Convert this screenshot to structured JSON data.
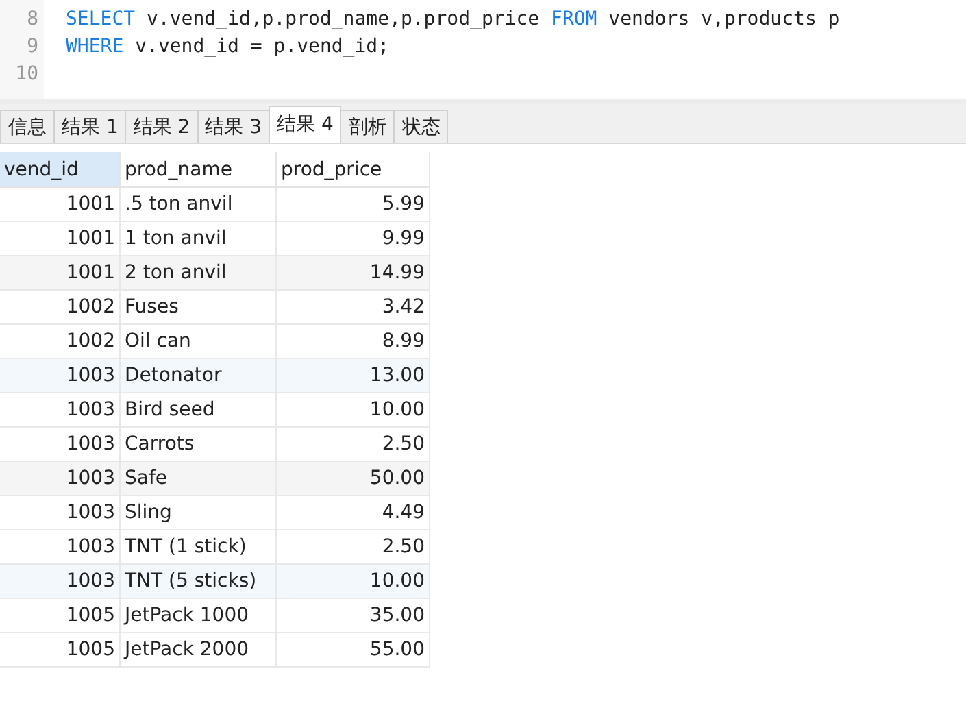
{
  "editor": {
    "lines": [
      {
        "number": "8",
        "tokens": [
          {
            "kind": "keyword",
            "text": "SELECT"
          },
          {
            "kind": "plain",
            "text": " v.vend_id,p.prod_name,p.prod_price "
          },
          {
            "kind": "keyword",
            "text": "FROM"
          },
          {
            "kind": "plain",
            "text": " vendors v,products p"
          }
        ]
      },
      {
        "number": "9",
        "tokens": [
          {
            "kind": "keyword",
            "text": "WHERE"
          },
          {
            "kind": "plain",
            "text": " v.vend_id = p.vend_id;"
          }
        ]
      },
      {
        "number": "10"
      }
    ]
  },
  "tabs": [
    {
      "label": "信息",
      "selected": false
    },
    {
      "label": "结果 1",
      "selected": false
    },
    {
      "label": "结果 2",
      "selected": false
    },
    {
      "label": "结果 3",
      "selected": false
    },
    {
      "label": "结果 4",
      "selected": true
    },
    {
      "label": "剖析",
      "selected": false
    },
    {
      "label": "状态",
      "selected": false
    }
  ],
  "table": {
    "columns": [
      {
        "label": "vend_id",
        "selected": true
      },
      {
        "label": "prod_name",
        "selected": false
      },
      {
        "label": "prod_price",
        "selected": false
      }
    ],
    "rows": [
      [
        "1001",
        ".5 ton anvil",
        "5.99"
      ],
      [
        "1001",
        "1 ton anvil",
        "9.99"
      ],
      [
        "1001",
        "2 ton anvil",
        "14.99"
      ],
      [
        "1002",
        "Fuses",
        "3.42"
      ],
      [
        "1002",
        "Oil can",
        "8.99"
      ],
      [
        "1003",
        "Detonator",
        "13.00"
      ],
      [
        "1003",
        "Bird seed",
        "10.00"
      ],
      [
        "1003",
        "Carrots",
        "2.50"
      ],
      [
        "1003",
        "Safe",
        "50.00"
      ],
      [
        "1003",
        "Sling",
        "4.49"
      ],
      [
        "1003",
        "TNT (1 stick)",
        "2.50"
      ],
      [
        "1003",
        "TNT (5 sticks)",
        "10.00"
      ],
      [
        "1005",
        "JetPack 1000",
        "35.00"
      ],
      [
        "1005",
        "JetPack 2000",
        "55.00"
      ]
    ]
  }
}
